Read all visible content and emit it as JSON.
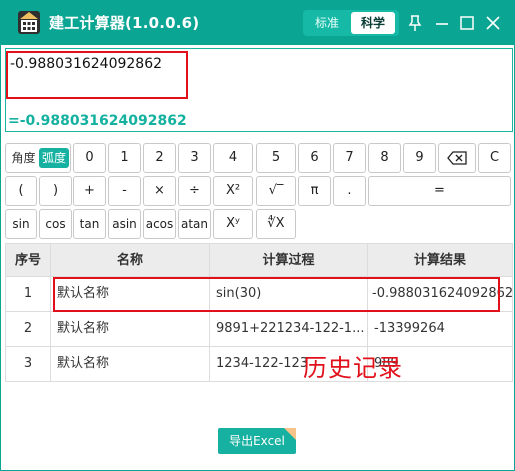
{
  "window": {
    "title": "建工计算器(1.0.0.6)",
    "modes": [
      "标准",
      "科学"
    ],
    "active_mode": "科学",
    "colors": {
      "primary": "#0aa593",
      "accent": "#16b1a0",
      "annotation": "#e2101b"
    }
  },
  "display": {
    "expression": "-0.988031624092862",
    "result": "=-0.988031624092862"
  },
  "keypad": {
    "angle": {
      "deg": "角度",
      "rad": "弧度",
      "active": "弧度"
    },
    "row1": [
      "0",
      "1",
      "2",
      "3",
      "4",
      "5",
      "6",
      "7",
      "8",
      "9",
      "⌫",
      "C"
    ],
    "row2": [
      "(",
      ")",
      "+",
      "-",
      "×",
      "÷",
      "X²",
      "√‾",
      "π",
      ".",
      "="
    ],
    "row3": [
      "sin",
      "cos",
      "tan",
      "asin",
      "acos",
      "atan",
      "Xʸ",
      "∜X"
    ]
  },
  "history": {
    "columns": [
      "序号",
      "名称",
      "计算过程",
      "计算结果"
    ],
    "rows": [
      {
        "index": "1",
        "name": "默认名称",
        "process": "sin(30)",
        "result": "-0.988031624092862"
      },
      {
        "index": "2",
        "name": "默认名称",
        "process": "9891+221234-122-1...",
        "result": "-13399264"
      },
      {
        "index": "3",
        "name": "默认名称",
        "process": "1234-122-123",
        "result": "989"
      }
    ],
    "annotation": "历史记录"
  },
  "export": {
    "label": "导出Excel"
  }
}
